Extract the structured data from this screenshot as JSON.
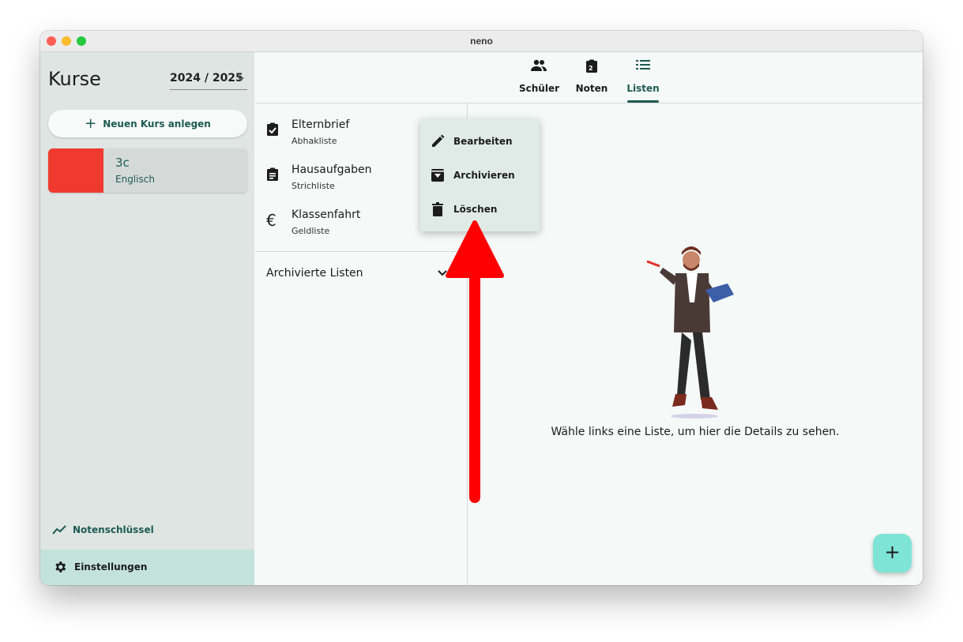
{
  "window": {
    "title": "neno"
  },
  "sidebar": {
    "title": "Kurse",
    "year": "2024 / 2025",
    "new_course_label": "Neuen Kurs anlegen",
    "courses": [
      {
        "name": "3c",
        "subject": "Englisch",
        "color": "#f03a2f"
      }
    ],
    "grade_key_label": "Notenschlüssel",
    "settings_label": "Einstellungen"
  },
  "tabs": [
    {
      "label": "Schüler",
      "icon": "people-icon",
      "active": false
    },
    {
      "label": "Noten",
      "icon": "grade-clipboard-icon",
      "active": false
    },
    {
      "label": "Listen",
      "icon": "list-icon",
      "active": true
    }
  ],
  "lists": {
    "items": [
      {
        "title": "Elternbrief",
        "subtitle": "Abhakliste",
        "icon": "clipboard-check-icon"
      },
      {
        "title": "Hausaufgaben",
        "subtitle": "Strichliste",
        "icon": "clipboard-text-icon"
      },
      {
        "title": "Klassenfahrt",
        "subtitle": "Geldliste",
        "icon": "euro-icon"
      }
    ],
    "archived_label": "Archivierte Listen"
  },
  "context_menu": {
    "items": [
      {
        "label": "Bearbeiten",
        "icon": "pencil-icon"
      },
      {
        "label": "Archivieren",
        "icon": "archive-icon"
      },
      {
        "label": "Löschen",
        "icon": "trash-icon"
      }
    ]
  },
  "detail": {
    "empty_message": "Wähle links eine Liste, um hier die Details zu sehen."
  },
  "fab": {
    "label": "+"
  },
  "colors": {
    "accent": "#1d5b52",
    "fab": "#7ee4d6",
    "annotation_arrow": "#ff0000"
  }
}
